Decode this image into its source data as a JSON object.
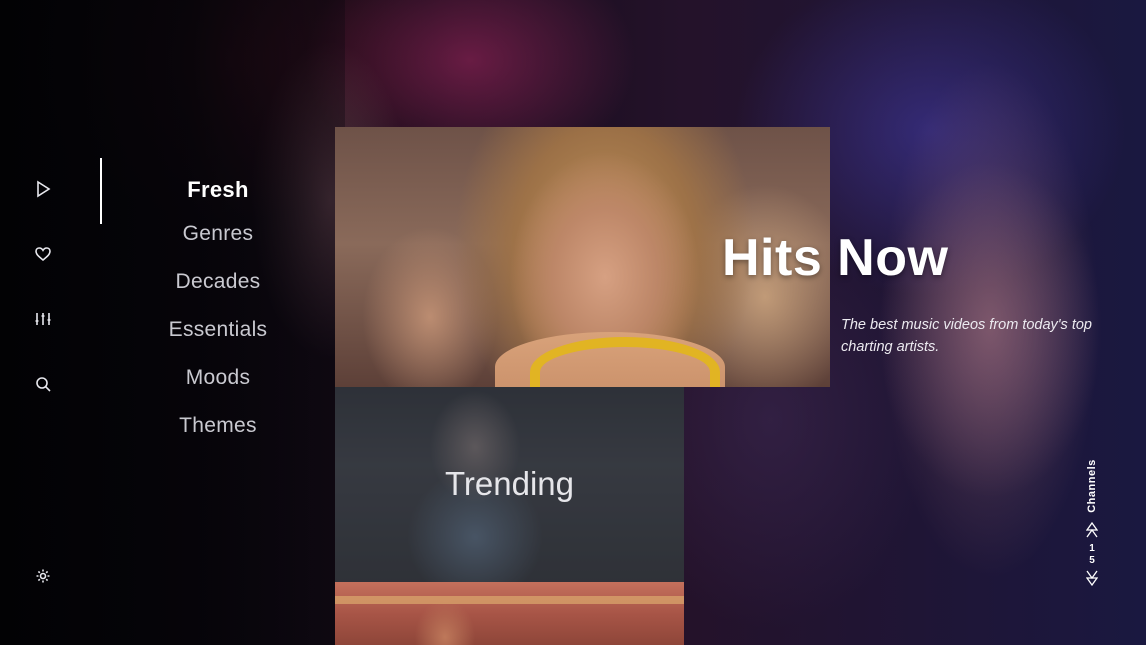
{
  "nav": {
    "rail": [
      {
        "icon": "play-icon",
        "label": "Play"
      },
      {
        "icon": "heart-icon",
        "label": "Favorites"
      },
      {
        "icon": "equalizer-icon",
        "label": "Settings sliders"
      },
      {
        "icon": "search-icon",
        "label": "Search"
      },
      {
        "icon": "gear-icon",
        "label": "Settings"
      }
    ],
    "menu": [
      {
        "label": "Fresh",
        "active": true
      },
      {
        "label": "Genres"
      },
      {
        "label": "Decades"
      },
      {
        "label": "Essentials"
      },
      {
        "label": "Moods"
      },
      {
        "label": "Themes"
      }
    ]
  },
  "featured": {
    "title": "Hits Now",
    "description": "The best music videos from today's top charting artists."
  },
  "cards": [
    {
      "title": ""
    },
    {
      "title": "Trending"
    },
    {
      "title": ""
    }
  ],
  "channels": {
    "label": "Channels",
    "current": "1",
    "total": "5"
  },
  "colors": {
    "accent": "#ffffff",
    "menu_inactive": "#c9c9d0",
    "hero_strap": "#e1b423"
  }
}
